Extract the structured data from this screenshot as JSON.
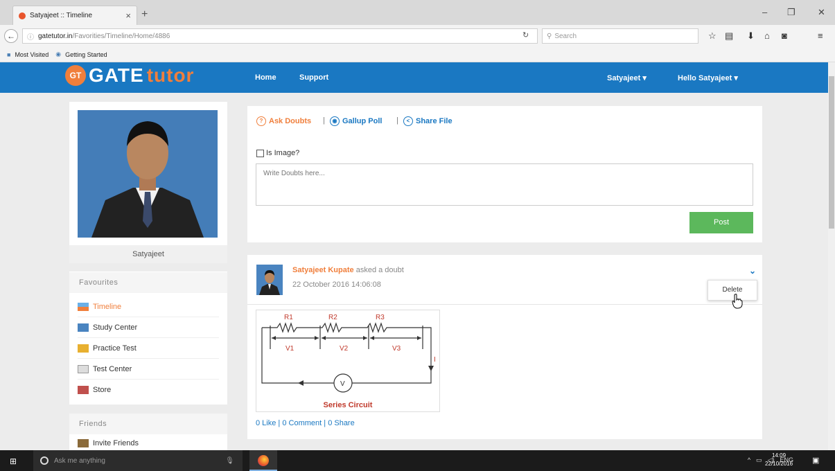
{
  "browser": {
    "tab_title": "Satyajeet :: Timeline",
    "tab_close": "×",
    "new_tab": "+",
    "url_host": "gatetutor.in",
    "url_path": "/Favorities/Timeline/Home/4886",
    "search_placeholder": "Search",
    "bookmarks": [
      "Most Visited",
      "Getting Started"
    ]
  },
  "site": {
    "logo_badge": "GT",
    "logo_gate": "GATE",
    "logo_tutor": "tutor",
    "nav": [
      "Home",
      "Support"
    ],
    "user_menu": "Satyajeet ▾",
    "hello_menu": "Hello Satyajeet ▾"
  },
  "profile": {
    "name": "Satyajeet"
  },
  "sidebar": {
    "favourites_title": "Favourites",
    "items": [
      {
        "label": "Timeline",
        "icon": "timeline-icon",
        "active": true
      },
      {
        "label": "Study Center",
        "icon": "study-center-icon",
        "active": false
      },
      {
        "label": "Practice Test",
        "icon": "practice-test-icon",
        "active": false
      },
      {
        "label": "Test Center",
        "icon": "test-center-icon",
        "active": false
      },
      {
        "label": "Store",
        "icon": "store-icon",
        "active": false
      }
    ],
    "friends_title": "Friends",
    "friends_items": [
      {
        "label": "Invite Friends",
        "icon": "invite-friends-icon"
      }
    ]
  },
  "composer": {
    "actions": [
      {
        "label": "Ask Doubts",
        "color": "#f07f3c"
      },
      {
        "label": "Gallup Poll",
        "color": "#1a78c2"
      },
      {
        "label": "Share File",
        "color": "#1a78c2"
      }
    ],
    "is_image_label": "Is Image?",
    "input_placeholder": "Write Doubts here...",
    "post_button": "Post"
  },
  "post": {
    "author": "Satyajeet Kupate",
    "verb": "asked a doubt",
    "date": "22 October 2016 14:06:08",
    "menu_item": "Delete",
    "image_caption": "Series Circuit",
    "image_labels": [
      "R1",
      "R2",
      "R3",
      "V1",
      "V2",
      "V3",
      "V",
      "I"
    ],
    "likes": "0 Like",
    "comments": "0 Comment",
    "shares": "0 Share"
  },
  "taskbar": {
    "search_placeholder": "Ask me anything",
    "lang": "ENG",
    "time": "14:09",
    "date": "22/10/2016"
  },
  "colors": {
    "brand_blue": "#1a78c2",
    "brand_orange": "#f07f3c",
    "post_green": "#5cb85c"
  }
}
